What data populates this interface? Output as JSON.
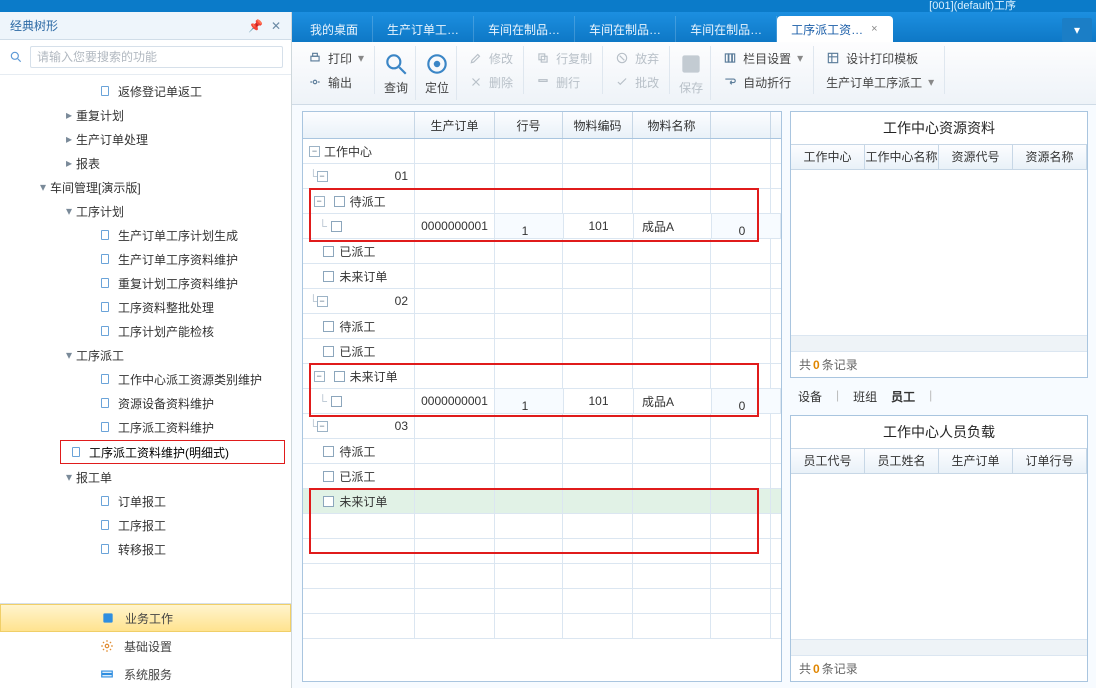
{
  "titlebar": "[001](default)工序",
  "sidebar": {
    "title": "经典树形",
    "search_placeholder": "请输入您要搜索的功能",
    "nodes": {
      "n0": "返修登记单返工",
      "n1": "重复计划",
      "n2": "生产订单处理",
      "n3": "报表",
      "n4": "车间管理[演示版]",
      "n5": "工序计划",
      "n6": "生产订单工序计划生成",
      "n7": "生产订单工序资料维护",
      "n8": "重复计划工序资料维护",
      "n9": "工序资料整批处理",
      "n10": "工序计划产能检核",
      "n11": "工序派工",
      "n12": "工作中心派工资源类别维护",
      "n13": "资源设备资料维护",
      "n14": "工序派工资料维护",
      "n15": "工序派工资料维护(明细式)",
      "n16": "报工单",
      "n17": "订单报工",
      "n18": "工序报工",
      "n19": "转移报工"
    },
    "footer": {
      "biz": "业务工作",
      "basic": "基础设置",
      "sys": "系统服务"
    }
  },
  "tabs": {
    "t0": "我的桌面",
    "t1": "生产订单工…",
    "t2": "车间在制品…",
    "t3": "车间在制品…",
    "t4": "车间在制品…",
    "t5": "工序派工资…"
  },
  "toolbar": {
    "print": "打印",
    "export": "输出",
    "query": "查询",
    "locate": "定位",
    "modify": "修改",
    "delete": "删除",
    "xcopy": "行复制",
    "xdel": "删行",
    "abandon": "放弃",
    "approve": "批改",
    "save": "保存",
    "colset": "栏目设置",
    "wrap": "自动折行",
    "design": "设计打印模板",
    "subdoc": "生产订单工序派工"
  },
  "grid": {
    "headers": {
      "h1": "生产订单",
      "h2": "行号",
      "h3": "物料编码",
      "h4": "物料名称",
      "h5": ""
    },
    "tree": {
      "root": "工作中心",
      "g01": "01",
      "g02": "02",
      "g03": "03",
      "pending": "待派工",
      "assigned": "已派工",
      "future": "未来订单"
    },
    "rows": {
      "r1": {
        "c1": "0000000001",
        "c2": "1",
        "c3": "101",
        "c4": "成品A",
        "c5": "0"
      },
      "r2": {
        "c1": "0000000001",
        "c2": "1",
        "c3": "101",
        "c4": "成品A",
        "c5": "0"
      }
    }
  },
  "panel1": {
    "title": "工作中心资源资料",
    "h1": "工作中心",
    "h2": "工作中心名称",
    "h3": "资源代号",
    "h4": "资源名称",
    "foot_pre": "共 ",
    "foot_num": "0",
    "foot_post": " 条记录"
  },
  "segtabs": {
    "a": "设备",
    "b": "班组",
    "c": "员工"
  },
  "panel2": {
    "title": "工作中心人员负载",
    "h1": "员工代号",
    "h2": "员工姓名",
    "h3": "生产订单",
    "h4": "订单行号",
    "foot_pre": "共 ",
    "foot_num": "0",
    "foot_post": " 条记录"
  }
}
